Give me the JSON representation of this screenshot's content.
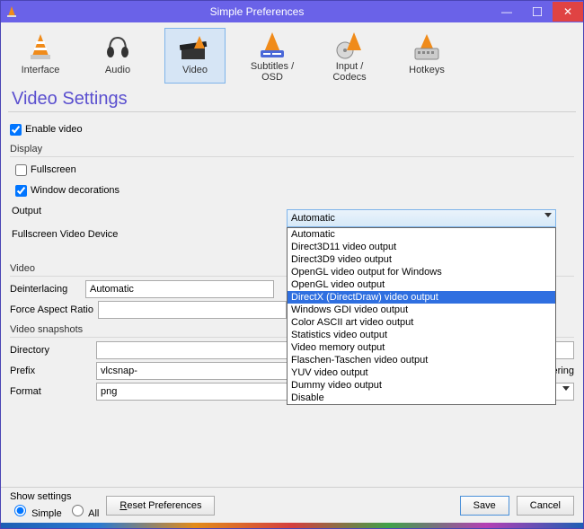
{
  "window": {
    "title": "Simple Preferences"
  },
  "toolbar": {
    "items": [
      {
        "label": "Interface"
      },
      {
        "label": "Audio"
      },
      {
        "label": "Video"
      },
      {
        "label": "Subtitles / OSD"
      },
      {
        "label": "Input / Codecs"
      },
      {
        "label": "Hotkeys"
      }
    ]
  },
  "heading": "Video Settings",
  "enable_video": {
    "label": "Enable video",
    "checked": true
  },
  "display_group": "Display",
  "fullscreen": {
    "label": "Fullscreen",
    "checked": false
  },
  "window_decorations": {
    "label": "Window decorations",
    "checked": true
  },
  "output": {
    "label": "Output",
    "selected": "Automatic",
    "options": [
      "Automatic",
      "Direct3D11 video output",
      "Direct3D9 video output",
      "OpenGL video output for Windows",
      "OpenGL video output",
      "DirectX (DirectDraw) video output",
      "Windows GDI video output",
      "Color ASCII art video output",
      "Statistics video output",
      "Video memory output",
      "Flaschen-Taschen video output",
      "YUV video output",
      "Dummy video output",
      "Disable"
    ],
    "highlighted_index": 5
  },
  "fullscreen_device": {
    "label": "Fullscreen Video Device"
  },
  "video_group": "Video",
  "deinterlacing": {
    "label": "Deinterlacing",
    "value": "Automatic"
  },
  "force_aspect": {
    "label": "Force Aspect Ratio",
    "value": ""
  },
  "snapshots_group": "Video snapshots",
  "directory": {
    "label": "Directory",
    "value": ""
  },
  "prefix": {
    "label": "Prefix",
    "value": "vlcsnap-"
  },
  "seq_numbering": {
    "label": "Sequential numbering",
    "checked": false
  },
  "format": {
    "label": "Format",
    "value": "png"
  },
  "footer": {
    "show_settings": "Show settings",
    "simple": "Simple",
    "all": "All",
    "reset": "Reset Preferences",
    "save": "Save",
    "cancel": "Cancel"
  }
}
